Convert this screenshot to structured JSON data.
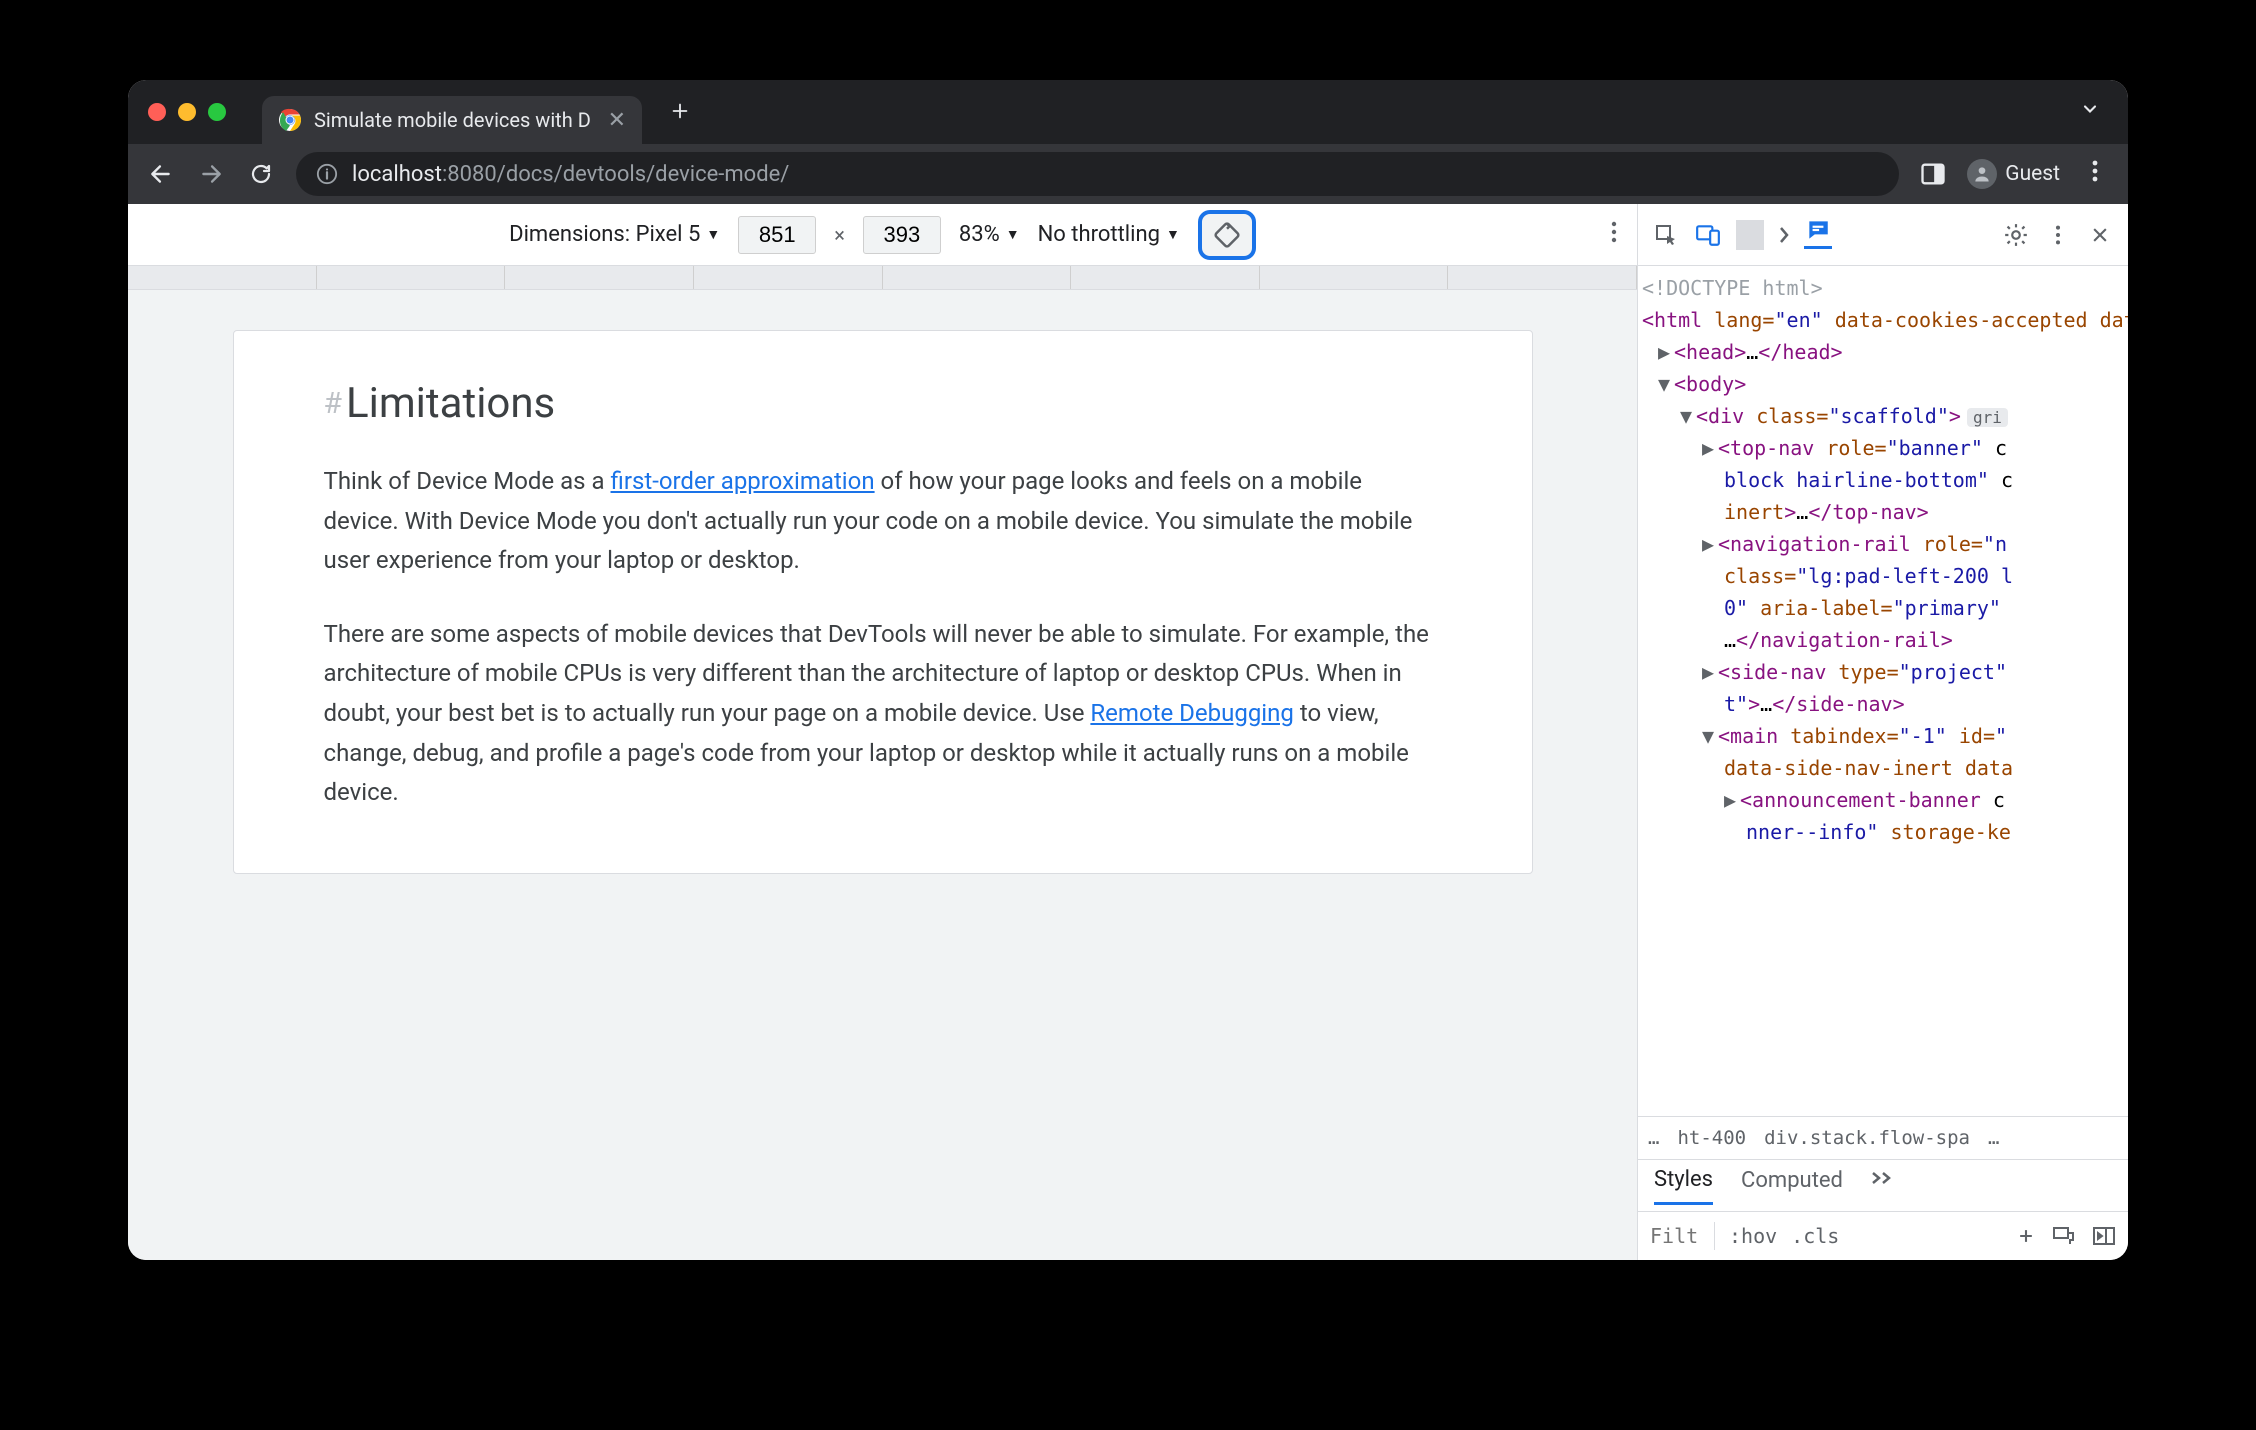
{
  "tab": {
    "title": "Simulate mobile devices with D",
    "close": "✕"
  },
  "urlbar": {
    "host": "localhost",
    "port_path": ":8080/docs/devtools/device-mode/",
    "profile": "Guest"
  },
  "device_toolbar": {
    "dimensions_label": "Dimensions: Pixel 5",
    "width": "851",
    "height": "393",
    "zoom": "83%",
    "throttling": "No throttling"
  },
  "page": {
    "hash": "#",
    "heading": "Limitations",
    "p1a": "Think of Device Mode as a ",
    "link1": "first-order approximation",
    "p1b": " of how your page looks and feels on a mobile device. With Device Mode you don't actually run your code on a mobile device. You simulate the mobile user experience from your laptop or desktop.",
    "p2a": "There are some aspects of mobile devices that DevTools will never be able to simulate. For example, the architecture of mobile CPUs is very different than the architecture of laptop or desktop CPUs. When in doubt, your best bet is to actually run your page on a mobile device. Use ",
    "link2": "Remote Debugging",
    "p2b": " to view, change, debug, and profile a page's code from your laptop or desktop while it actually runs on a mobile device."
  },
  "dom": {
    "doctype": "<!DOCTYPE html>",
    "html_open": "<html lang=\"en\" data-cookies-accepted data-banner-dismissed>",
    "head": "<head>…</head>",
    "body": "<body>",
    "div_scaffold": "<div class=\"scaffold\">",
    "grid_pill": "gri",
    "topnav1": "<top-nav role=\"banner\" c",
    "topnav2": "block hairline-bottom\" c",
    "topnav3": "inert>…</top-nav>",
    "navrail1": "<navigation-rail role=\"n",
    "navrail2": "class=\"lg:pad-left-200 l",
    "navrail3": "0\" aria-label=\"primary\"",
    "navrail4": "…</navigation-rail>",
    "sidenav1": "<side-nav type=\"project\"",
    "sidenav2": "t\">…</side-nav>",
    "main1": "<main tabindex=\"-1\" id=\"",
    "main2": "data-side-nav-inert data",
    "ann1": "<announcement-banner c",
    "ann2": "nner--info\" storage-ke"
  },
  "breadcrumb": {
    "dots": "…",
    "b1": "ht-400",
    "b2": "div.stack.flow-spa",
    "b3": "…"
  },
  "styles": {
    "tab_styles": "Styles",
    "tab_computed": "Computed",
    "filter_placeholder": "Filt",
    "hov": ":hov",
    "cls": ".cls"
  }
}
